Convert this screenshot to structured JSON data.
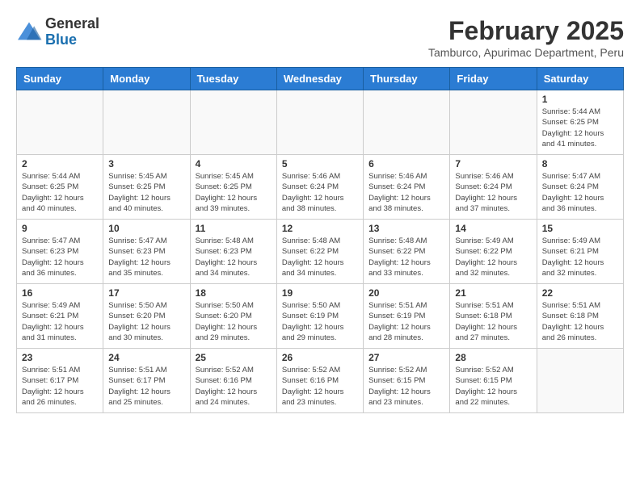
{
  "header": {
    "logo_general": "General",
    "logo_blue": "Blue",
    "main_title": "February 2025",
    "subtitle": "Tamburco, Apurimac Department, Peru"
  },
  "calendar": {
    "days_of_week": [
      "Sunday",
      "Monday",
      "Tuesday",
      "Wednesday",
      "Thursday",
      "Friday",
      "Saturday"
    ],
    "weeks": [
      [
        {
          "day": "",
          "info": ""
        },
        {
          "day": "",
          "info": ""
        },
        {
          "day": "",
          "info": ""
        },
        {
          "day": "",
          "info": ""
        },
        {
          "day": "",
          "info": ""
        },
        {
          "day": "",
          "info": ""
        },
        {
          "day": "1",
          "info": "Sunrise: 5:44 AM\nSunset: 6:25 PM\nDaylight: 12 hours\nand 41 minutes."
        }
      ],
      [
        {
          "day": "2",
          "info": "Sunrise: 5:44 AM\nSunset: 6:25 PM\nDaylight: 12 hours\nand 40 minutes."
        },
        {
          "day": "3",
          "info": "Sunrise: 5:45 AM\nSunset: 6:25 PM\nDaylight: 12 hours\nand 40 minutes."
        },
        {
          "day": "4",
          "info": "Sunrise: 5:45 AM\nSunset: 6:25 PM\nDaylight: 12 hours\nand 39 minutes."
        },
        {
          "day": "5",
          "info": "Sunrise: 5:46 AM\nSunset: 6:24 PM\nDaylight: 12 hours\nand 38 minutes."
        },
        {
          "day": "6",
          "info": "Sunrise: 5:46 AM\nSunset: 6:24 PM\nDaylight: 12 hours\nand 38 minutes."
        },
        {
          "day": "7",
          "info": "Sunrise: 5:46 AM\nSunset: 6:24 PM\nDaylight: 12 hours\nand 37 minutes."
        },
        {
          "day": "8",
          "info": "Sunrise: 5:47 AM\nSunset: 6:24 PM\nDaylight: 12 hours\nand 36 minutes."
        }
      ],
      [
        {
          "day": "9",
          "info": "Sunrise: 5:47 AM\nSunset: 6:23 PM\nDaylight: 12 hours\nand 36 minutes."
        },
        {
          "day": "10",
          "info": "Sunrise: 5:47 AM\nSunset: 6:23 PM\nDaylight: 12 hours\nand 35 minutes."
        },
        {
          "day": "11",
          "info": "Sunrise: 5:48 AM\nSunset: 6:23 PM\nDaylight: 12 hours\nand 34 minutes."
        },
        {
          "day": "12",
          "info": "Sunrise: 5:48 AM\nSunset: 6:22 PM\nDaylight: 12 hours\nand 34 minutes."
        },
        {
          "day": "13",
          "info": "Sunrise: 5:48 AM\nSunset: 6:22 PM\nDaylight: 12 hours\nand 33 minutes."
        },
        {
          "day": "14",
          "info": "Sunrise: 5:49 AM\nSunset: 6:22 PM\nDaylight: 12 hours\nand 32 minutes."
        },
        {
          "day": "15",
          "info": "Sunrise: 5:49 AM\nSunset: 6:21 PM\nDaylight: 12 hours\nand 32 minutes."
        }
      ],
      [
        {
          "day": "16",
          "info": "Sunrise: 5:49 AM\nSunset: 6:21 PM\nDaylight: 12 hours\nand 31 minutes."
        },
        {
          "day": "17",
          "info": "Sunrise: 5:50 AM\nSunset: 6:20 PM\nDaylight: 12 hours\nand 30 minutes."
        },
        {
          "day": "18",
          "info": "Sunrise: 5:50 AM\nSunset: 6:20 PM\nDaylight: 12 hours\nand 29 minutes."
        },
        {
          "day": "19",
          "info": "Sunrise: 5:50 AM\nSunset: 6:19 PM\nDaylight: 12 hours\nand 29 minutes."
        },
        {
          "day": "20",
          "info": "Sunrise: 5:51 AM\nSunset: 6:19 PM\nDaylight: 12 hours\nand 28 minutes."
        },
        {
          "day": "21",
          "info": "Sunrise: 5:51 AM\nSunset: 6:18 PM\nDaylight: 12 hours\nand 27 minutes."
        },
        {
          "day": "22",
          "info": "Sunrise: 5:51 AM\nSunset: 6:18 PM\nDaylight: 12 hours\nand 26 minutes."
        }
      ],
      [
        {
          "day": "23",
          "info": "Sunrise: 5:51 AM\nSunset: 6:17 PM\nDaylight: 12 hours\nand 26 minutes."
        },
        {
          "day": "24",
          "info": "Sunrise: 5:51 AM\nSunset: 6:17 PM\nDaylight: 12 hours\nand 25 minutes."
        },
        {
          "day": "25",
          "info": "Sunrise: 5:52 AM\nSunset: 6:16 PM\nDaylight: 12 hours\nand 24 minutes."
        },
        {
          "day": "26",
          "info": "Sunrise: 5:52 AM\nSunset: 6:16 PM\nDaylight: 12 hours\nand 23 minutes."
        },
        {
          "day": "27",
          "info": "Sunrise: 5:52 AM\nSunset: 6:15 PM\nDaylight: 12 hours\nand 23 minutes."
        },
        {
          "day": "28",
          "info": "Sunrise: 5:52 AM\nSunset: 6:15 PM\nDaylight: 12 hours\nand 22 minutes."
        },
        {
          "day": "",
          "info": ""
        }
      ]
    ]
  }
}
